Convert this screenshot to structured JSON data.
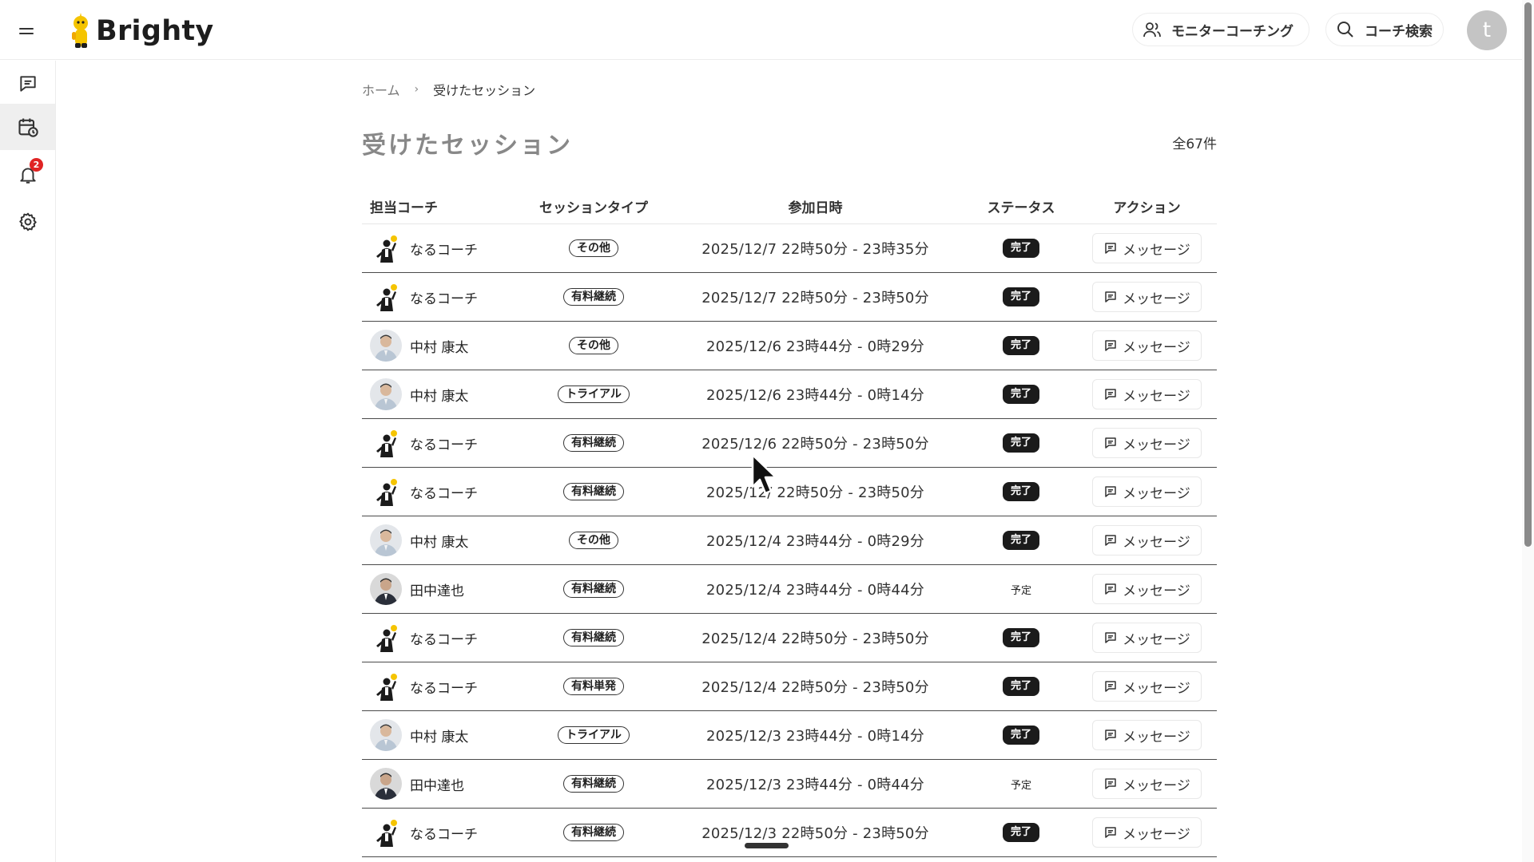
{
  "app": {
    "name": "Brighty"
  },
  "header": {
    "monitor_coaching_label": "モニターコーチング",
    "coach_search_label": "コーチ検索",
    "avatar_initial": "t"
  },
  "sidebar": {
    "items": [
      {
        "name": "messages",
        "icon": "chat-icon"
      },
      {
        "name": "sessions",
        "icon": "calendar-clock-icon",
        "active": true
      },
      {
        "name": "notifications",
        "icon": "bell-icon",
        "badge": "2"
      },
      {
        "name": "settings",
        "icon": "gear-icon"
      }
    ]
  },
  "breadcrumb": {
    "home": "ホーム",
    "separator": "›",
    "current": "受けたセッション"
  },
  "page": {
    "title": "受けたセッション",
    "total": "全67件"
  },
  "table": {
    "headers": {
      "coach": "担当コーチ",
      "type": "セッションタイプ",
      "date": "参加日時",
      "status": "ステータス",
      "action": "アクション"
    },
    "rows": [
      {
        "coach": "なるコーチ",
        "avatar": "illustration",
        "type": "その他",
        "date": "2025/12/7 22時50分 - 23時35分",
        "status": "完了",
        "status_kind": "done",
        "action": "メッセージ"
      },
      {
        "coach": "なるコーチ",
        "avatar": "illustration",
        "type": "有料継続",
        "date": "2025/12/7 22時50分 - 23時50分",
        "status": "完了",
        "status_kind": "done",
        "action": "メッセージ"
      },
      {
        "coach": "中村 康太",
        "avatar": "photo-light",
        "type": "その他",
        "date": "2025/12/6 23時44分 - 0時29分",
        "status": "完了",
        "status_kind": "done",
        "action": "メッセージ"
      },
      {
        "coach": "中村 康太",
        "avatar": "photo-light",
        "type": "トライアル",
        "date": "2025/12/6 23時44分 - 0時14分",
        "status": "完了",
        "status_kind": "done",
        "action": "メッセージ"
      },
      {
        "coach": "なるコーチ",
        "avatar": "illustration",
        "type": "有料継続",
        "date": "2025/12/6 22時50分 - 23時50分",
        "status": "完了",
        "status_kind": "done",
        "action": "メッセージ"
      },
      {
        "coach": "なるコーチ",
        "avatar": "illustration",
        "type": "有料継続",
        "date": "2025/12/  22時50分 - 23時50分",
        "status": "完了",
        "status_kind": "done",
        "action": "メッセージ"
      },
      {
        "coach": "中村 康太",
        "avatar": "photo-light",
        "type": "その他",
        "date": "2025/12/4 23時44分 - 0時29分",
        "status": "完了",
        "status_kind": "done",
        "action": "メッセージ"
      },
      {
        "coach": "田中達也",
        "avatar": "photo-dark",
        "type": "有料継続",
        "date": "2025/12/4 23時44分 - 0時44分",
        "status": "予定",
        "status_kind": "planned",
        "action": "メッセージ"
      },
      {
        "coach": "なるコーチ",
        "avatar": "illustration",
        "type": "有料継続",
        "date": "2025/12/4 22時50分 - 23時50分",
        "status": "完了",
        "status_kind": "done",
        "action": "メッセージ"
      },
      {
        "coach": "なるコーチ",
        "avatar": "illustration",
        "type": "有料単発",
        "date": "2025/12/4 22時50分 - 23時50分",
        "status": "完了",
        "status_kind": "done",
        "action": "メッセージ"
      },
      {
        "coach": "中村 康太",
        "avatar": "photo-light",
        "type": "トライアル",
        "date": "2025/12/3 23時44分 - 0時14分",
        "status": "完了",
        "status_kind": "done",
        "action": "メッセージ"
      },
      {
        "coach": "田中達也",
        "avatar": "photo-dark",
        "type": "有料継続",
        "date": "2025/12/3 23時44分 - 0時44分",
        "status": "予定",
        "status_kind": "planned",
        "action": "メッセージ"
      },
      {
        "coach": "なるコーチ",
        "avatar": "illustration",
        "type": "有料継続",
        "date": "2025/12/3 22時50分 - 23時50分",
        "status": "完了",
        "status_kind": "done",
        "action": "メッセージ"
      }
    ]
  },
  "colors": {
    "badge": "#e02424",
    "status_done_bg": "#1b1b1b",
    "logo_yellow": "#f5c400"
  }
}
